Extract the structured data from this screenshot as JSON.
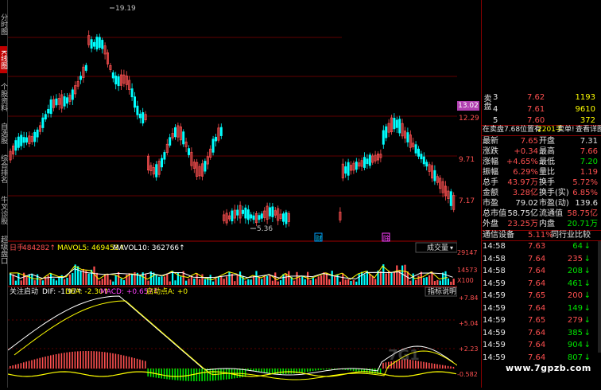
{
  "sidebar": {
    "tabs": [
      {
        "label": "分时图",
        "active": false
      },
      {
        "label": "K线图",
        "active": true
      },
      {
        "label": "个股资料",
        "active": false
      },
      {
        "label": "自选股",
        "active": false
      },
      {
        "label": "综合排名",
        "active": false
      },
      {
        "label": "牛叉诊股",
        "active": false
      },
      {
        "label": "超级盘口",
        "active": false
      }
    ]
  },
  "main": {
    "high_marker": "19.19",
    "low_marker": "5.36",
    "event_tag_1": "财",
    "event_tag_2": "除",
    "price_axis": [
      "13.02",
      "12.29",
      "9.71",
      "7.17"
    ],
    "volume_header": {
      "name": "日手",
      "value": "484282↑",
      "ma5": "MAVOL5: 469453↑",
      "ma10": "MAVOL10: 362766↑",
      "dropdown": "成交量"
    },
    "volume_axis": [
      "29147",
      "14573",
      "X100"
    ],
    "macd_header": {
      "name": "关注启动",
      "dif": "DIF: -1.97↑",
      "dea": "DEA: -2.30↑",
      "macd": "MACD: +0.657↑",
      "point": "启动点A: +0",
      "help_button": "指标说明"
    },
    "macd_axis": [
      "+7.84",
      "+5.04",
      "+2.23",
      "-0.582"
    ]
  },
  "order_book": {
    "side_label": "卖盘",
    "rows": [
      {
        "level": "3",
        "price": "7.62",
        "volume": "1193"
      },
      {
        "level": "4",
        "price": "7.61",
        "volume": "9610"
      },
      {
        "level": "5",
        "price": "7.60",
        "volume": "372"
      }
    ]
  },
  "info_bar": {
    "text": "在卖盘7.68位置有",
    "amount": "2201手",
    "label": "卖单!",
    "link": "查看详图"
  },
  "stats": [
    {
      "l1": "最新",
      "v1": "7.65",
      "l2": "开盘",
      "v2": "7.31"
    },
    {
      "l1": "涨跌",
      "v1": "+0.34",
      "l2": "最高",
      "v2": "7.66"
    },
    {
      "l1": "涨幅",
      "v1": "+4.65%",
      "l2": "最低",
      "v2": "7.20"
    },
    {
      "l1": "振幅",
      "v1": "6.29%",
      "l2": "量比",
      "v2": "1.19"
    },
    {
      "l1": "总手",
      "v1": "43.97万",
      "l2": "换手",
      "v2": "5.72%"
    },
    {
      "l1": "金额",
      "v1": "3.28亿",
      "l2": "换手(实)",
      "v2": "6.85%"
    },
    {
      "l1": "市盈",
      "v1": "79.02",
      "l2": "市盈(动)",
      "v2": "139.6"
    },
    {
      "l1": "总市值",
      "v1": "58.75亿",
      "l2": "流通值",
      "v2": "58.75亿"
    },
    {
      "l1": "外盘",
      "v1": "23.25万",
      "l2": "内盘",
      "v2": "20.71万"
    }
  ],
  "sector": {
    "name": "通信设备",
    "change": "5.11%",
    "link": "同行业比较"
  },
  "ticks": [
    {
      "time": "14:58",
      "price": "7.63",
      "vol": "64",
      "dir": "down"
    },
    {
      "time": "14:58",
      "price": "7.64",
      "vol": "235",
      "dir": "down"
    },
    {
      "time": "14:58",
      "price": "7.64",
      "vol": "208",
      "dir": "down"
    },
    {
      "time": "14:59",
      "price": "7.64",
      "vol": "461",
      "dir": "down"
    },
    {
      "time": "14:59",
      "price": "7.65",
      "vol": "200",
      "dir": "down"
    },
    {
      "time": "14:59",
      "price": "7.64",
      "vol": "149",
      "dir": "down"
    },
    {
      "time": "14:59",
      "price": "7.65",
      "vol": "279",
      "dir": "down"
    },
    {
      "time": "14:59",
      "price": "7.64",
      "vol": "385",
      "dir": "down"
    },
    {
      "time": "14:59",
      "price": "7.64",
      "vol": "904",
      "dir": "down"
    },
    {
      "time": "14:59",
      "price": "7.64",
      "vol": "807",
      "dir": "down"
    }
  ],
  "watermark": "www.7gpzb.com",
  "watermark_bg": "7G1",
  "colors": {
    "up": "#ff5050",
    "down": "#00e600",
    "ma": "#ffff00",
    "dif": "#ffffff",
    "bg": "#000000"
  }
}
